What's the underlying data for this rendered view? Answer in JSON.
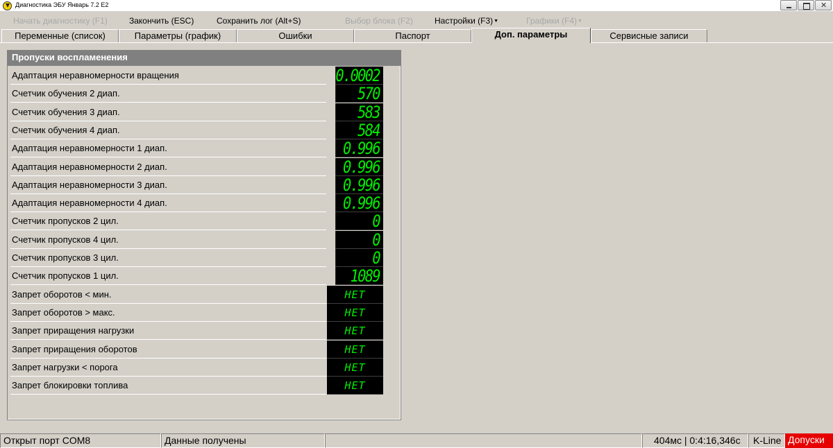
{
  "window": {
    "title": "Диагностика ЭБУ Январь 7.2 E2"
  },
  "menu": {
    "items": [
      {
        "label": "Начать диагностику (F1)",
        "disabled": true,
        "dropdown": false
      },
      {
        "label": "Закончить (ESC)",
        "disabled": false,
        "dropdown": false
      },
      {
        "label": "Сохранить лог (Alt+S)",
        "disabled": false,
        "dropdown": false
      },
      {
        "label": "Выбор блока (F2)",
        "disabled": true,
        "dropdown": false
      },
      {
        "label": "Настройки (F3)",
        "disabled": false,
        "dropdown": true
      },
      {
        "label": "Графики (F4)",
        "disabled": true,
        "dropdown": true
      }
    ]
  },
  "tabs": [
    {
      "label": "Переменные (список)",
      "active": false
    },
    {
      "label": "Параметры (график)",
      "active": false
    },
    {
      "label": "Ошибки",
      "active": false
    },
    {
      "label": "Паспорт",
      "active": false
    },
    {
      "label": "Доп. параметры",
      "active": true
    },
    {
      "label": "Сервисные записи",
      "active": false
    }
  ],
  "panel": {
    "title": "Пропуски воспламенения",
    "rows": [
      {
        "label": "Адаптация неравномерности вращения",
        "value": "0.0002",
        "kind": "num"
      },
      {
        "label": "Счетчик обучения 2 диап.",
        "value": "570",
        "kind": "num"
      },
      {
        "label": "Счетчик обучения 3 диап.",
        "value": "583",
        "kind": "num"
      },
      {
        "label": "Счетчик обучения 4 диап.",
        "value": "584",
        "kind": "num"
      },
      {
        "label": "Адаптация неравномерности 1 диап.",
        "value": "0.996",
        "kind": "num"
      },
      {
        "label": "Адаптация неравномерности 2 диап.",
        "value": "0.996",
        "kind": "num"
      },
      {
        "label": "Адаптация неравномерности 3 диап.",
        "value": "0.996",
        "kind": "num"
      },
      {
        "label": "Адаптация неравномерности 4 диап.",
        "value": "0.996",
        "kind": "num"
      },
      {
        "label": "Счетчик пропусков 2 цил.",
        "value": "0",
        "kind": "num"
      },
      {
        "label": "Счетчик пропусков 4 цил.",
        "value": "0",
        "kind": "num"
      },
      {
        "label": "Счетчик пропусков 3 цил.",
        "value": "0",
        "kind": "num"
      },
      {
        "label": "Счетчик пропусков 1 цил.",
        "value": "1089",
        "kind": "num"
      },
      {
        "label": "Запрет оборотов < мин.",
        "value": "НЕТ",
        "kind": "txt"
      },
      {
        "label": "Запрет оборотов > макс.",
        "value": "НЕТ",
        "kind": "txt"
      },
      {
        "label": "Запрет приращения нагрузки",
        "value": "НЕТ",
        "kind": "txt"
      },
      {
        "label": "Запрет приращения оборотов",
        "value": "НЕТ",
        "kind": "txt"
      },
      {
        "label": "Запрет нагрузки < порога",
        "value": "НЕТ",
        "kind": "txt"
      },
      {
        "label": "Запрет блокировки топлива",
        "value": "НЕТ",
        "kind": "txt"
      }
    ]
  },
  "status": {
    "port": "Открыт порт COM8",
    "data": "Данные получены",
    "empty": "",
    "timing": "404мс | 0:4:16,346с",
    "protocol": "K-Line",
    "mode": "Допуски"
  },
  "colors": {
    "display_green": "#00ee00",
    "display_bg": "#000000",
    "panel_header": "#808080",
    "status_alert": "#e60000"
  }
}
